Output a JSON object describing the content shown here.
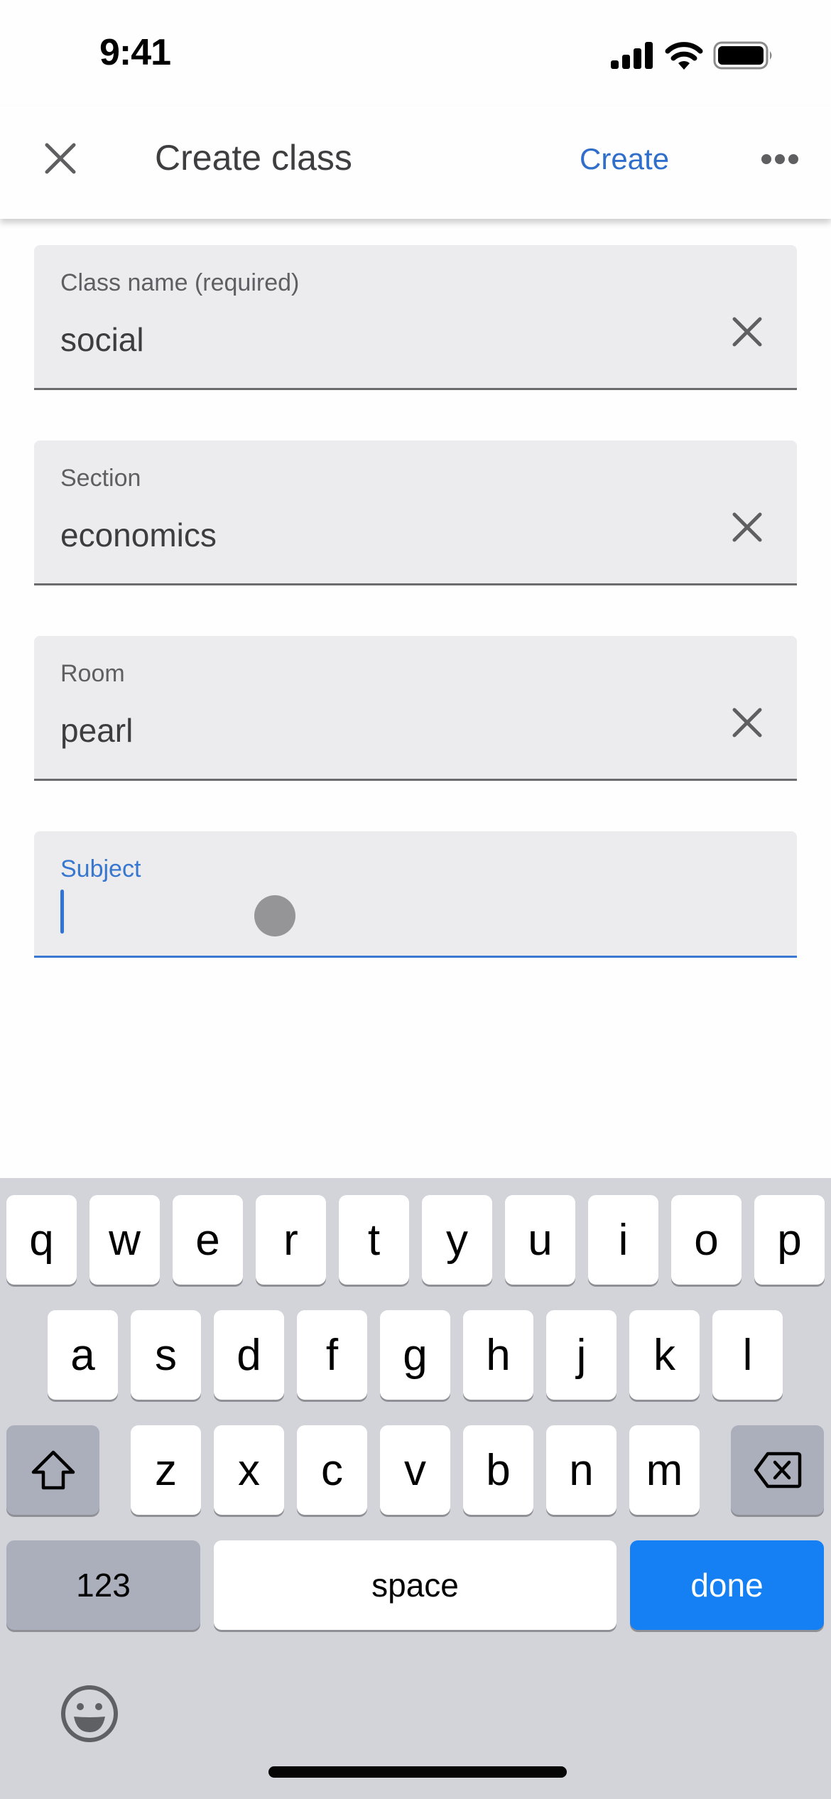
{
  "status_bar": {
    "time": "9:41",
    "icons": [
      "cellular-signal-icon",
      "wifi-icon",
      "battery-icon"
    ]
  },
  "app_bar": {
    "close_icon": "close-icon",
    "title": "Create class",
    "create_label": "Create",
    "more_icon": "more-horizontal-icon"
  },
  "form": {
    "fields": [
      {
        "label": "Class name (required)",
        "value": "social",
        "clear_icon": "clear-icon"
      },
      {
        "label": "Section",
        "value": "economics",
        "clear_icon": "clear-icon"
      },
      {
        "label": "Room",
        "value": "pearl",
        "clear_icon": "clear-icon"
      },
      {
        "label": "Subject",
        "value": "",
        "focused": true
      }
    ]
  },
  "colors": {
    "accent": "#2f6fcb",
    "field_bg": "#ecebee",
    "keyboard_bg": "#d3d4d9",
    "done_key": "#1580f3"
  },
  "keyboard": {
    "row1": [
      "q",
      "w",
      "e",
      "r",
      "t",
      "y",
      "u",
      "i",
      "o",
      "p"
    ],
    "row2": [
      "a",
      "s",
      "d",
      "f",
      "g",
      "h",
      "j",
      "k",
      "l"
    ],
    "row3": [
      "z",
      "x",
      "c",
      "v",
      "b",
      "n",
      "m"
    ],
    "shift_icon": "shift-icon",
    "backspace_icon": "backspace-icon",
    "numbers_label": "123",
    "space_label": "space",
    "done_label": "done",
    "emoji_icon": "emoji-icon"
  }
}
